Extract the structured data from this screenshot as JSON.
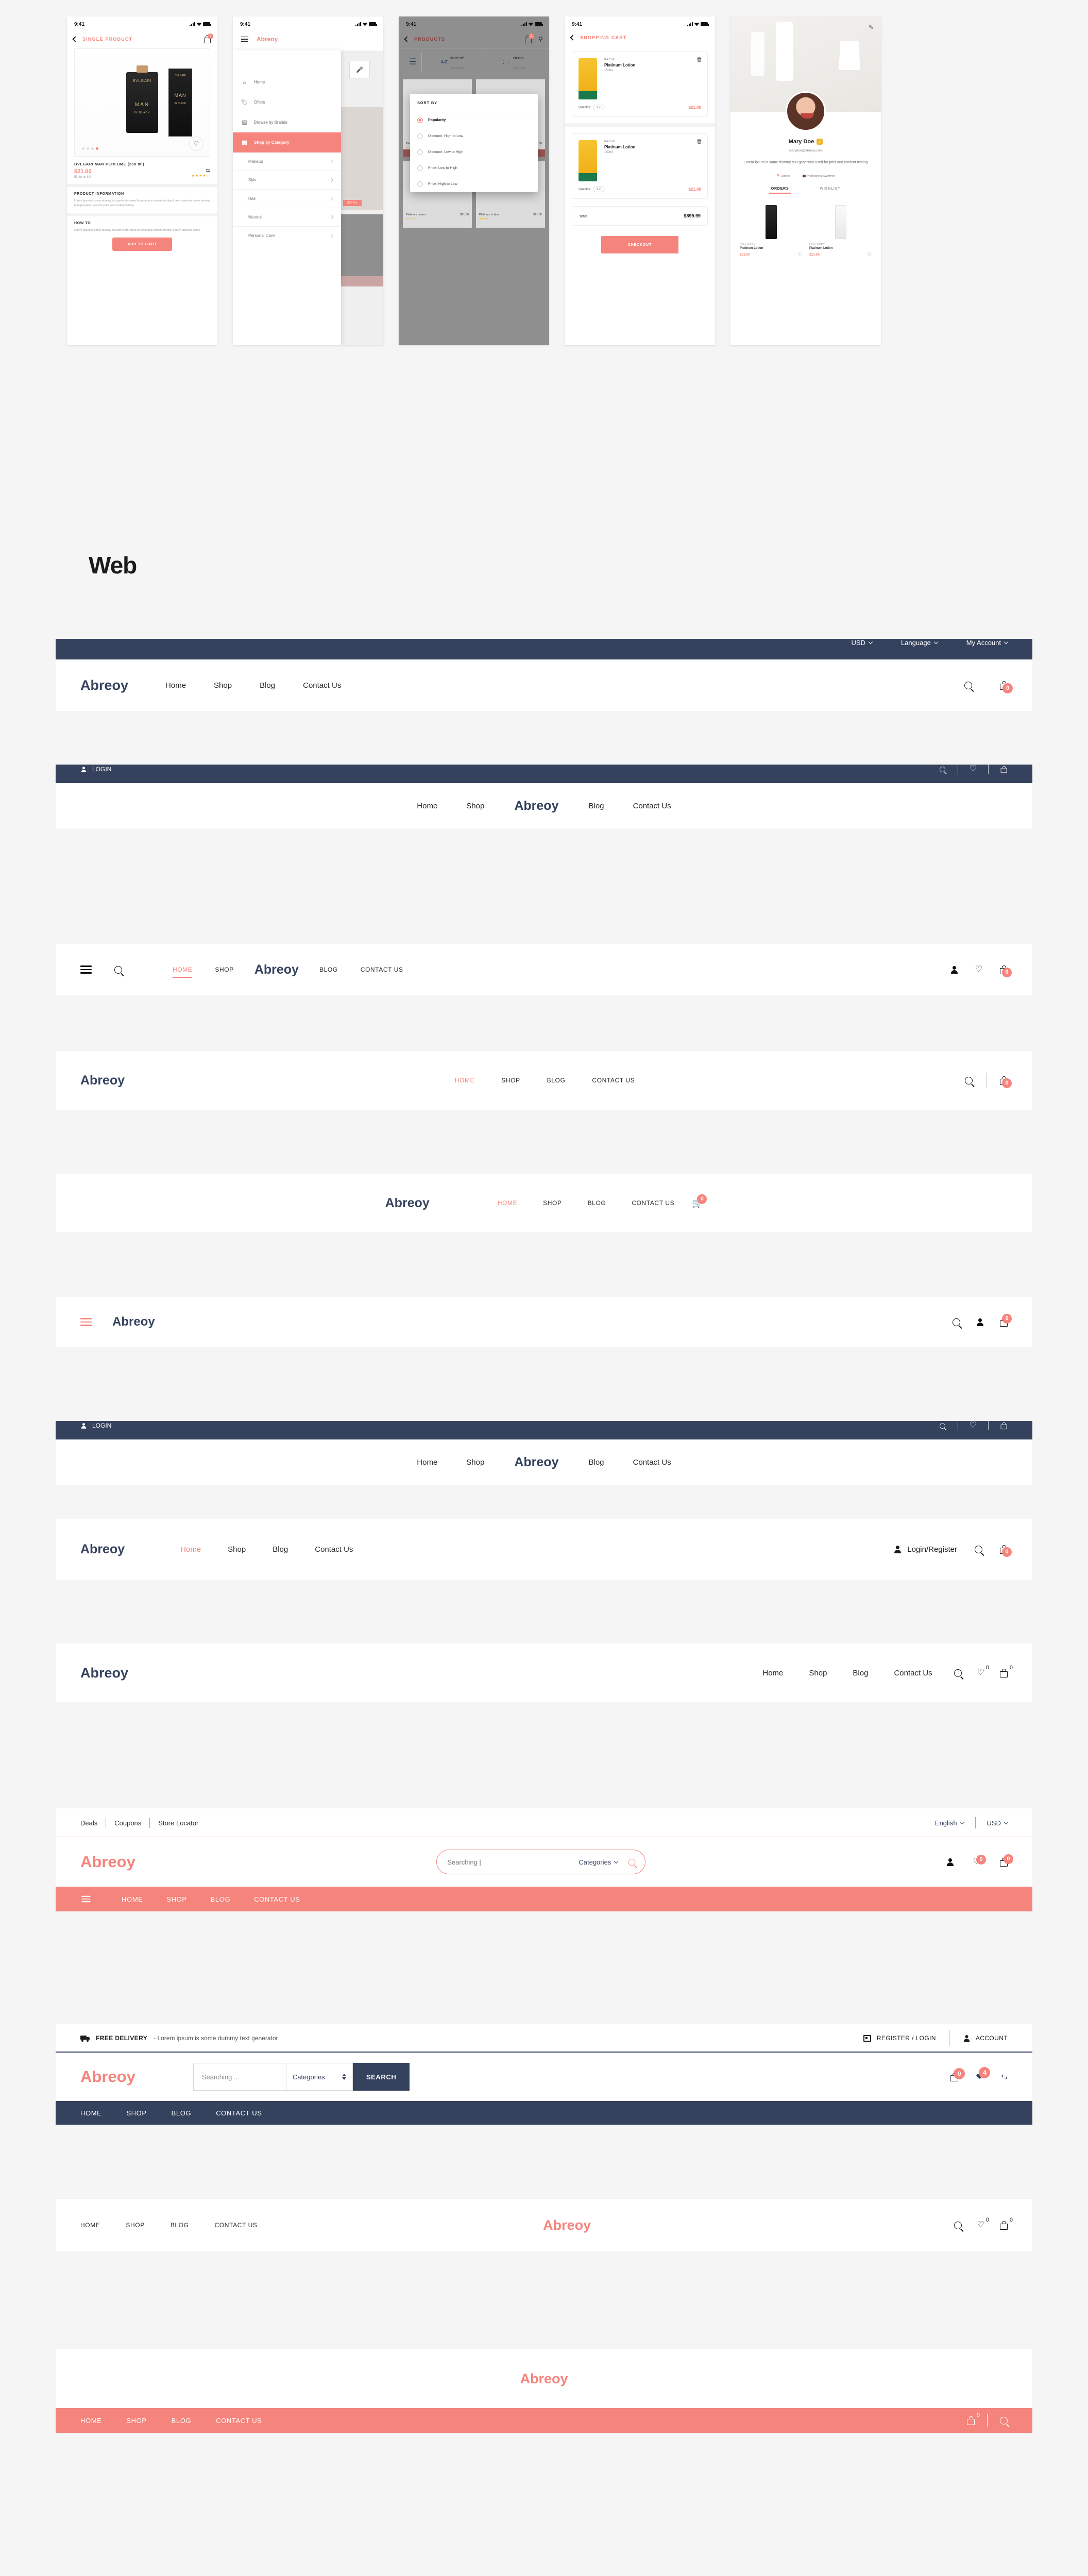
{
  "section_title": "Web",
  "brand": "Abreoy",
  "colors": {
    "navy": "#35425e",
    "coral": "#f5847c",
    "page_bg": "#f5f5f5",
    "white": "#ffffff"
  },
  "mobile": {
    "status_time": "9:41",
    "screen1": {
      "title": "SINGLE PRODUCT",
      "cart_badge": "2",
      "product_name": "BVLGARI MAN PERFUME  (250 ml)",
      "price": "$21.00",
      "stock": "53 Items left",
      "rating": "★★★★☆",
      "bottle_brand": "BVLGARI",
      "bottle_line1": "BVLGARI",
      "bottle_line2": "MAN",
      "bottle_line3": "IN BLACK",
      "info_heading": "PRODUCT INFORMATION",
      "info_body": "Lorem ipsum is some dummy text generator used for print and content testing. Lorem ipsum is some dummy text generator used for print and content testing.",
      "howto_heading": "HOW TO",
      "howto_body": "Lorem ipsum is some dummy text generator used for print and content testing. Lorem ipsum is some",
      "cta": "ADD TO CART"
    },
    "screen2": {
      "brand": "Abreoy",
      "items": [
        {
          "label": "Home",
          "icon": "home-icon"
        },
        {
          "label": "Offers",
          "icon": "tag-icon"
        },
        {
          "label": "Browse by Brands",
          "icon": "grid-icon"
        },
        {
          "label": "Shop by Category",
          "icon": "category-icon",
          "active": true
        }
      ],
      "categories": [
        "Makeup",
        "Skin",
        "Hair",
        "Natural",
        "Personal Care"
      ]
    },
    "screen3": {
      "title": "PRODUCTS",
      "cart_badge": "2",
      "toolbar": [
        {
          "l1": "SORT BY",
          "l2": "Alpabetically"
        },
        {
          "l1": "FILTER",
          "l2": "Apply Filters"
        }
      ],
      "modal_title": "SORT BY",
      "options": [
        "Popularity",
        "Discount: High to Low",
        "Discount: Low to High",
        "Price: Low to High",
        "Price: High to Low"
      ],
      "selected_option": "Popularity",
      "products": [
        {
          "name": "Platinum Lotion",
          "price": "$21.00",
          "stars": "★★★★☆",
          "cta": "ADD TO CART"
        },
        {
          "name": "Platinum Lotion",
          "price": "$21.00",
          "stars": "★★★★☆",
          "cta": "ADD TO CART"
        },
        {
          "name": "Platinum Lotion",
          "price": "$21.00",
          "stars": "★★★★☆",
          "cta": ""
        },
        {
          "name": "Platinum Lotion",
          "price": "$21.00",
          "stars": "★★★★☆",
          "cta": ""
        }
      ]
    },
    "screen4": {
      "title": "SHOPPING CART",
      "items": [
        {
          "category": "FACIAL",
          "name": "Platinum Lotion",
          "size": "150ml",
          "qty_label": "Quantity:",
          "qty": "2",
          "price": "$21.00"
        },
        {
          "category": "FACIAL",
          "name": "Platinum Lotion",
          "size": "150ml",
          "qty_label": "Quantity:",
          "qty": "2",
          "price": "$21.00"
        }
      ],
      "total_label": "Total",
      "total_value": "$899.99",
      "checkout": "CHECKOUT"
    },
    "screen5": {
      "name": "Mary Doe",
      "email": "marydoe@abreoy.com",
      "bio": "Lorem ipsum is some dummy text generator used for print and content testing",
      "location": "Estonia",
      "job": "Professional Swimmer",
      "tabs": [
        "ORDERS",
        "WISHLIST"
      ],
      "active_tab": "ORDERS",
      "orders": [
        {
          "category": "FULL BODY",
          "name": "Platinum Lotion",
          "price": "$21.00"
        },
        {
          "category": "FULL BODY",
          "name": "Platinum Lotion",
          "price": "$21.00"
        }
      ]
    }
  },
  "navbars": [
    {
      "id": "nav-1",
      "topbar": {
        "currency": "USD",
        "language": "Language",
        "account": "My Account"
      },
      "links": [
        "Home",
        "Shop",
        "Blog",
        "Contact Us"
      ],
      "cart_badge": "0"
    },
    {
      "id": "nav-2",
      "login": "LOGIN",
      "links_left": [
        "Home",
        "Shop"
      ],
      "links_right": [
        "Blog",
        "Contact Us"
      ]
    },
    {
      "id": "nav-3",
      "links_left": [
        "HOME",
        "SHOP"
      ],
      "links_right": [
        "BLOG",
        "CONTACT US"
      ],
      "active": "HOME",
      "cart_badge": "0"
    },
    {
      "id": "nav-4",
      "links": [
        "HOME",
        "SHOP",
        "BLOG",
        "CONTACT US"
      ],
      "active": "HOME",
      "cart_badge": "0"
    },
    {
      "id": "nav-5",
      "links": [
        "HOME",
        "SHOP",
        "BLOG",
        "CONTACT US"
      ],
      "active": "HOME",
      "cart_badge": "0"
    },
    {
      "id": "nav-6",
      "cart_badge": "0"
    },
    {
      "id": "nav-7",
      "login": "LOGIN",
      "links_left": [
        "Home",
        "Shop"
      ],
      "links_right": [
        "Blog",
        "Contact Us"
      ]
    },
    {
      "id": "nav-8",
      "links": [
        "Home",
        "Shop",
        "Blog",
        "Contact Us"
      ],
      "active": "Home",
      "login_register": "Login/Register",
      "cart_badge": "0"
    },
    {
      "id": "nav-9",
      "links": [
        "Home",
        "Shop",
        "Blog",
        "Contact Us"
      ],
      "wishlist_badge": "0",
      "cart_badge": "0"
    },
    {
      "id": "nav-10",
      "toplinks": [
        "Deals",
        "Coupons",
        "Store Locator"
      ],
      "language": "English",
      "currency": "USD",
      "search_placeholder": "Searching |",
      "categories": "Categories",
      "wishlist_badge": "0",
      "cart_badge": "0",
      "links": [
        "HOME",
        "SHOP",
        "BLOG",
        "CONTACT US"
      ]
    },
    {
      "id": "nav-11",
      "delivery_label": "FREE DELIVERY",
      "delivery_text": "- Lorem ipsum is some dummy text generator",
      "register_login": "REGISTER / LOGIN",
      "account": "ACCOUNT",
      "search_placeholder": "Searching ...",
      "categories": "Categories",
      "search_button": "SEARCH",
      "cart_badge": "0",
      "wishlist_badge": "4",
      "links": [
        "HOME",
        "SHOP",
        "BLOG",
        "CONTACT US"
      ]
    },
    {
      "id": "nav-12",
      "links": [
        "HOME",
        "SHOP",
        "BLOG",
        "CONTACT US"
      ],
      "wishlist_badge": "0",
      "cart_badge": "0"
    },
    {
      "id": "nav-13",
      "links": [
        "HOME",
        "SHOP",
        "BLOG",
        "CONTACT US"
      ],
      "cart_badge": "0"
    }
  ]
}
